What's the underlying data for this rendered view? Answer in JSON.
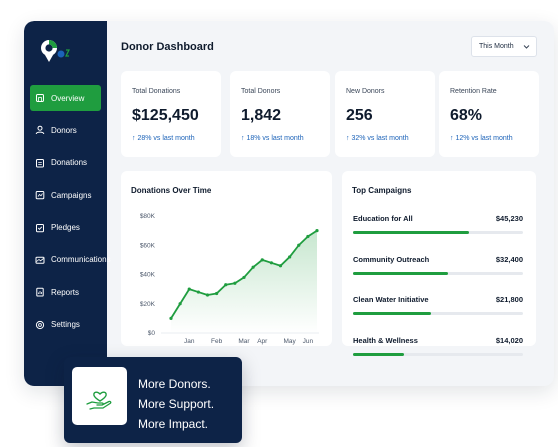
{
  "header": {
    "title": "Donor Dashboard",
    "range_selected": "This Month"
  },
  "sidebar": {
    "items": [
      {
        "label": "Overview",
        "icon": "home-icon",
        "active": true
      },
      {
        "label": "Donors",
        "icon": "user-icon",
        "active": false
      },
      {
        "label": "Donations",
        "icon": "clipboard-icon",
        "active": false
      },
      {
        "label": "Campaigns",
        "icon": "campaign-icon",
        "active": false
      },
      {
        "label": "Pledges",
        "icon": "pledge-icon",
        "active": false
      },
      {
        "label": "Communications",
        "icon": "mail-icon",
        "active": false
      },
      {
        "label": "Reports",
        "icon": "report-icon",
        "active": false
      },
      {
        "label": "Settings",
        "icon": "gear-icon",
        "active": false
      }
    ]
  },
  "stats": [
    {
      "label": "Total Donations",
      "value": "$125,450",
      "change": "↑ 28% vs last month"
    },
    {
      "label": "Total Donors",
      "value": "1,842",
      "change": "↑ 18% vs last month"
    },
    {
      "label": "New Donors",
      "value": "256",
      "change": "↑ 32% vs last month"
    },
    {
      "label": "Retention Rate",
      "value": "68%",
      "change": "↑ 12% vs last month"
    }
  ],
  "chart_data": {
    "type": "line",
    "title": "Donations Over Time",
    "xlabel": "",
    "ylabel": "",
    "x": [
      0,
      0.5,
      1,
      1.5,
      2,
      2.5,
      3,
      3.5,
      4,
      4.5,
      5,
      5.5,
      6,
      6.5,
      7,
      7.5,
      8
    ],
    "x_tick_labels": [
      "Jan",
      "Feb",
      "Mar",
      "Apr",
      "May",
      "Jun"
    ],
    "x_tick_positions": [
      1,
      2.5,
      4,
      5,
      6.5,
      7.5
    ],
    "series": [
      {
        "values": [
          1.5,
          2.8,
          3.8,
          3.2,
          3.0,
          2.9,
          3.3,
          3.6,
          3.9,
          4.3,
          5.0,
          5.8,
          5.6,
          4.9,
          5.6,
          6.7,
          7.0
        ]
      }
    ],
    "y_tick_labels": [
      "$0",
      "$20K",
      "$40K",
      "$60K",
      "$80K"
    ],
    "ylim": [
      0,
      80
    ],
    "series_values_k": [
      10,
      20,
      30,
      28,
      26,
      27,
      33,
      34,
      38,
      45,
      50,
      48,
      46,
      52,
      60,
      66,
      70
    ],
    "grid": false,
    "color": "#1f9d3f"
  },
  "top_campaigns": {
    "title": "Top Campaigns",
    "items": [
      {
        "name": "Education for All",
        "value": "$45,230",
        "progress": 0.68
      },
      {
        "name": "Community Outreach",
        "value": "$32,400",
        "progress": 0.56
      },
      {
        "name": "Clean Water Initiative",
        "value": "$21,800",
        "progress": 0.46
      },
      {
        "name": "Health & Wellness",
        "value": "$14,020",
        "progress": 0.3
      }
    ]
  },
  "promo": {
    "icon": "heart-hand-icon",
    "lines": [
      "More Donors.",
      "More Support.",
      "More Impact."
    ]
  },
  "colors": {
    "sidebar": "#0d2347",
    "accent": "#1f9d3f",
    "change": "#1b62b8"
  }
}
